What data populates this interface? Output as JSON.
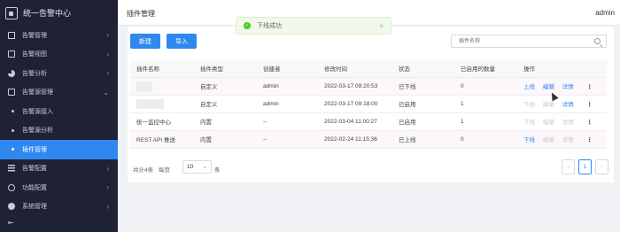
{
  "sidebar": {
    "brand_title": "统一告警中心",
    "items": [
      {
        "label": "告警管理",
        "icon": "home-icon"
      },
      {
        "label": "告警视图",
        "icon": "view-icon"
      },
      {
        "label": "告警分析",
        "icon": "pie-chart-icon"
      },
      {
        "label": "告警源管理",
        "icon": "source-icon"
      },
      {
        "label": "告警源接入"
      },
      {
        "label": "告警源分析"
      },
      {
        "label": "插件管理"
      },
      {
        "label": "告警配置",
        "icon": "config-icon"
      },
      {
        "label": "功能配置",
        "icon": "function-icon"
      },
      {
        "label": "系统管理",
        "icon": "gear-icon"
      }
    ],
    "collapse_glyph": "⇤"
  },
  "header": {
    "page_title": "插件管理",
    "user": "admin"
  },
  "toast": {
    "message": "下线成功",
    "close": "×"
  },
  "toolbar": {
    "new_label": "新建",
    "import_label": "导入",
    "search_placeholder": "插件名称"
  },
  "table": {
    "columns": [
      "插件名称",
      "插件类型",
      "创建者",
      "修改时间",
      "状态",
      "已启用的数量",
      "操作"
    ],
    "rows": [
      {
        "name": "",
        "type": "自定义",
        "creator": "admin",
        "modified": "2022-03-17 09:20:53",
        "status": "已下线",
        "count": "0",
        "ops": [
          {
            "label": "上线",
            "enabled": true
          },
          {
            "label": "编辑",
            "enabled": true
          },
          {
            "label": "详情",
            "enabled": true
          }
        ]
      },
      {
        "name": "",
        "type": "自定义",
        "creator": "admin",
        "modified": "2022-03-17 09:18:00",
        "status": "已启用",
        "count": "1",
        "ops": [
          {
            "label": "下线",
            "enabled": false
          },
          {
            "label": "编辑",
            "enabled": false
          },
          {
            "label": "详情",
            "enabled": true
          }
        ]
      },
      {
        "name": "统一监控中心",
        "type": "内置",
        "creator": "--",
        "modified": "2022-03-04 11:00:27",
        "status": "已启用",
        "count": "1",
        "ops": [
          {
            "label": "下线",
            "enabled": false
          },
          {
            "label": "编辑",
            "enabled": false
          },
          {
            "label": "详情",
            "enabled": false
          }
        ]
      },
      {
        "name": "REST API 推送",
        "type": "内置",
        "creator": "--",
        "modified": "2022-02-24 11:15:36",
        "status": "已上线",
        "count": "0",
        "ops": [
          {
            "label": "下线",
            "enabled": true
          },
          {
            "label": "编辑",
            "enabled": false
          },
          {
            "label": "详情",
            "enabled": false
          }
        ]
      }
    ],
    "more_glyph": "⋮"
  },
  "pagination": {
    "total": "共计4条",
    "per_page_label": "每页",
    "page_size": "10",
    "unit": "条",
    "prev": "‹",
    "current": "1",
    "next": "›"
  },
  "colors": {
    "primary": "#2f88f0",
    "sidebar_bg": "#1f2235",
    "success": "#52c41a"
  }
}
